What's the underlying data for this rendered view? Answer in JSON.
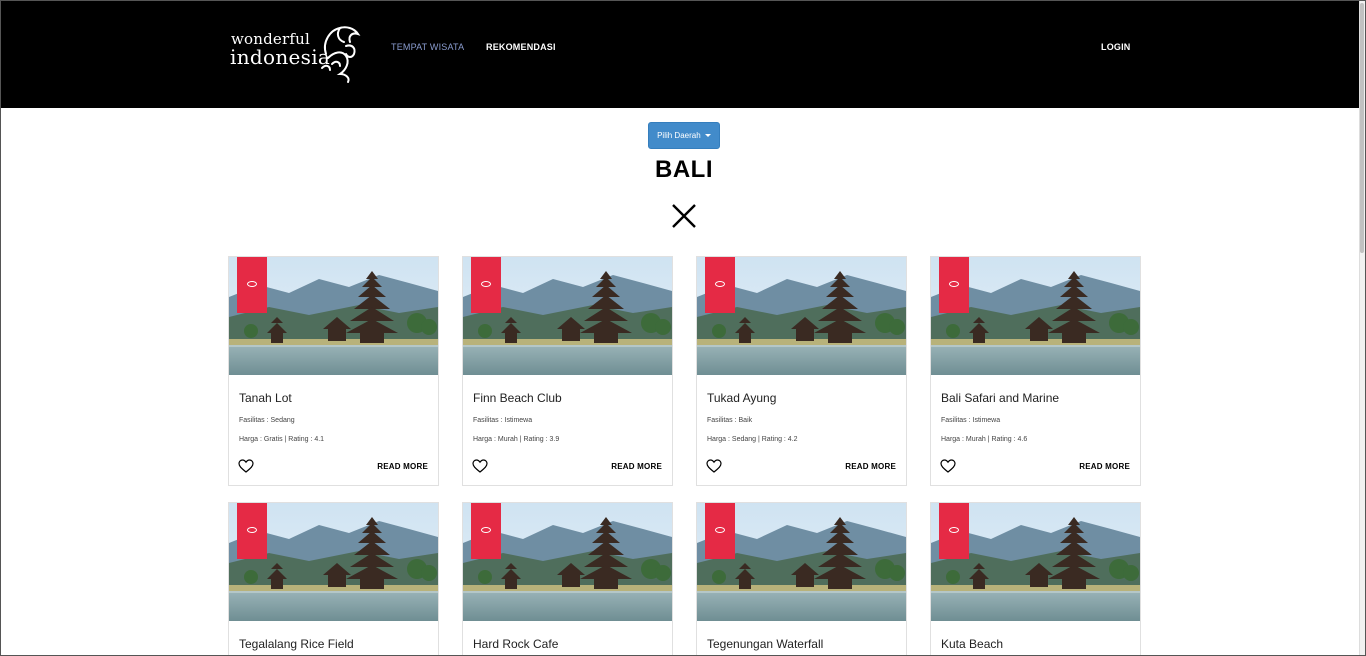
{
  "brand": {
    "line1": "wonderful",
    "line2": "indonesia"
  },
  "nav": {
    "links": [
      {
        "label": "TEMPAT WISATA",
        "active": true
      },
      {
        "label": "REKOMENDASI",
        "active": false
      }
    ],
    "login": "LOGIN"
  },
  "filter": {
    "dropdown_label": "Pilih Daerah",
    "region": "BALI"
  },
  "colors": {
    "navbar": "#000000",
    "badge": "#e52a45",
    "button": "#428bca",
    "active_link": "#8a9ccf"
  },
  "cards": [
    {
      "name": "Tanah Lot",
      "facility": "Fasilitas : Sedang",
      "meta": "Harga : Gratis | Rating : 4.1",
      "read_more": "READ MORE"
    },
    {
      "name": "Finn Beach Club",
      "facility": "Fasilitas : Istimewa",
      "meta": "Harga : Murah | Rating : 3.9",
      "read_more": "READ MORE"
    },
    {
      "name": "Tukad Ayung",
      "facility": "Fasilitas : Baik",
      "meta": "Harga : Sedang | Rating : 4.2",
      "read_more": "READ MORE"
    },
    {
      "name": "Bali Safari and Marine",
      "facility": "Fasilitas : Istimewa",
      "meta": "Harga : Murah | Rating : 4.6",
      "read_more": "READ MORE"
    },
    {
      "name": "Tegalalang Rice Field"
    },
    {
      "name": "Hard Rock Cafe"
    },
    {
      "name": "Tegenungan Waterfall"
    },
    {
      "name": "Kuta Beach"
    }
  ]
}
